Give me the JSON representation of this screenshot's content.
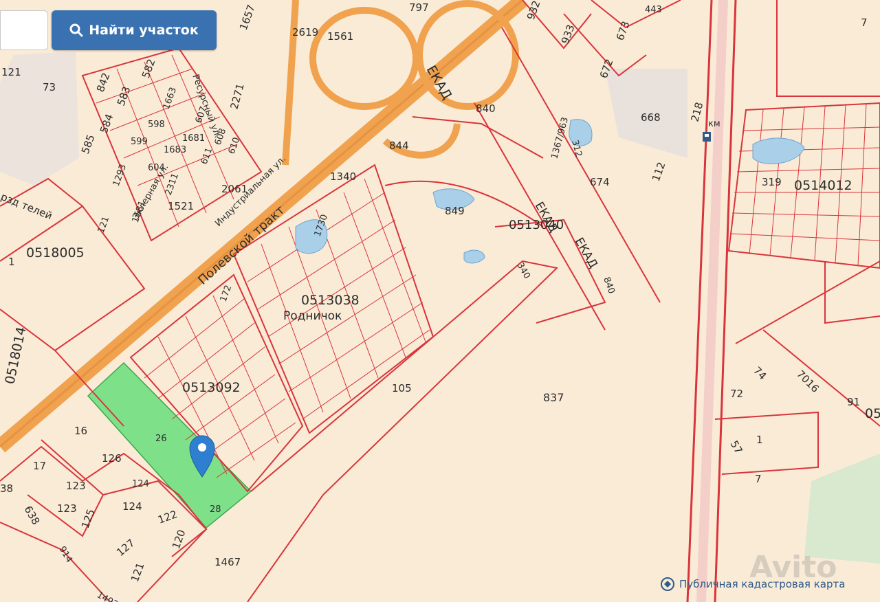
{
  "search": {
    "button_label": "Найти участок",
    "input_value": ""
  },
  "map": {
    "highlight_color": "#7fe08a",
    "road_color": "#f0a24e",
    "boundary_color": "#d9343b",
    "labels": {
      "l_797": "797",
      "l_443": "443",
      "l_7": "7",
      "l_1657": "1657",
      "l_2619": "2619",
      "l_1561": "1561",
      "l_932": "932",
      "l_933": "933",
      "l_673": "673",
      "l_672": "672",
      "l_121": "121",
      "l_73": "73",
      "l_842": "842",
      "l_582": "582",
      "l_583": "583",
      "l_584": "584",
      "l_585": "585",
      "l_1663": "1663",
      "l_598": "598",
      "l_599": "599",
      "l_607": "607",
      "l_608": "608",
      "l_610": "610",
      "l_611": "611",
      "l_1681": "1681",
      "l_1683": "1683",
      "l_604": "604",
      "l_2271": "2271",
      "l_ekad1": "ЕКАД",
      "l_840a": "840",
      "l_844": "844",
      "l_1367": "1367/963",
      "l_312": "312",
      "l_668": "668",
      "l_218": "218",
      "l_km": "км",
      "l_1293": "1293",
      "l_2311": "2311",
      "l_2061": "2061",
      "l_1340": "1340",
      "l_674": "674",
      "l_112": "112",
      "l_319": "319",
      "l_0514012": "0514012",
      "l_street1": "Эклерная ул.",
      "l_street2": "Индустриальная ул.",
      "l_street3": "Ресурсный ул.",
      "l_street4": "Полевской тракт",
      "l_1521": "1521",
      "l_1681b": "1681",
      "l_1730": "1730",
      "l_849": "849",
      "l_0513040": "0513040",
      "l_ekad2": "ЕКАД",
      "l_ekad3": "ЕКАД",
      "l_840b": "840",
      "l_340": "340",
      "l_0518005": "0518005",
      "l_1": "1",
      "l_121b": "121",
      "l_dneli": "рзд телей",
      "l_0513038": "0513038",
      "l_rodnichok": "Родничок",
      "l_172": "172",
      "l_0518014": "0518014",
      "l_0513092": "0513092",
      "l_105": "105",
      "l_837": "837",
      "l_74": "74",
      "l_7016": "7016",
      "l_91": "91",
      "l_72": "72",
      "l_05": "05",
      "l_57": "57",
      "l_1c": "1",
      "l_7b": "7",
      "l_16": "16",
      "l_26": "26",
      "l_17": "17",
      "l_126": "126",
      "l_123": "123",
      "l_123b": "123",
      "l_124": "124",
      "l_124b": "124",
      "l_38": "38",
      "l_638": "638",
      "l_125": "125",
      "l_122": "122",
      "l_28": "28",
      "l_914": "914",
      "l_127": "127",
      "l_120": "120",
      "l_1467": "1467",
      "l_121c": "121",
      "l_1492": "1492"
    }
  },
  "footer": {
    "label": "Публичная кадастровая карта"
  },
  "watermark": {
    "text": "Avito"
  }
}
